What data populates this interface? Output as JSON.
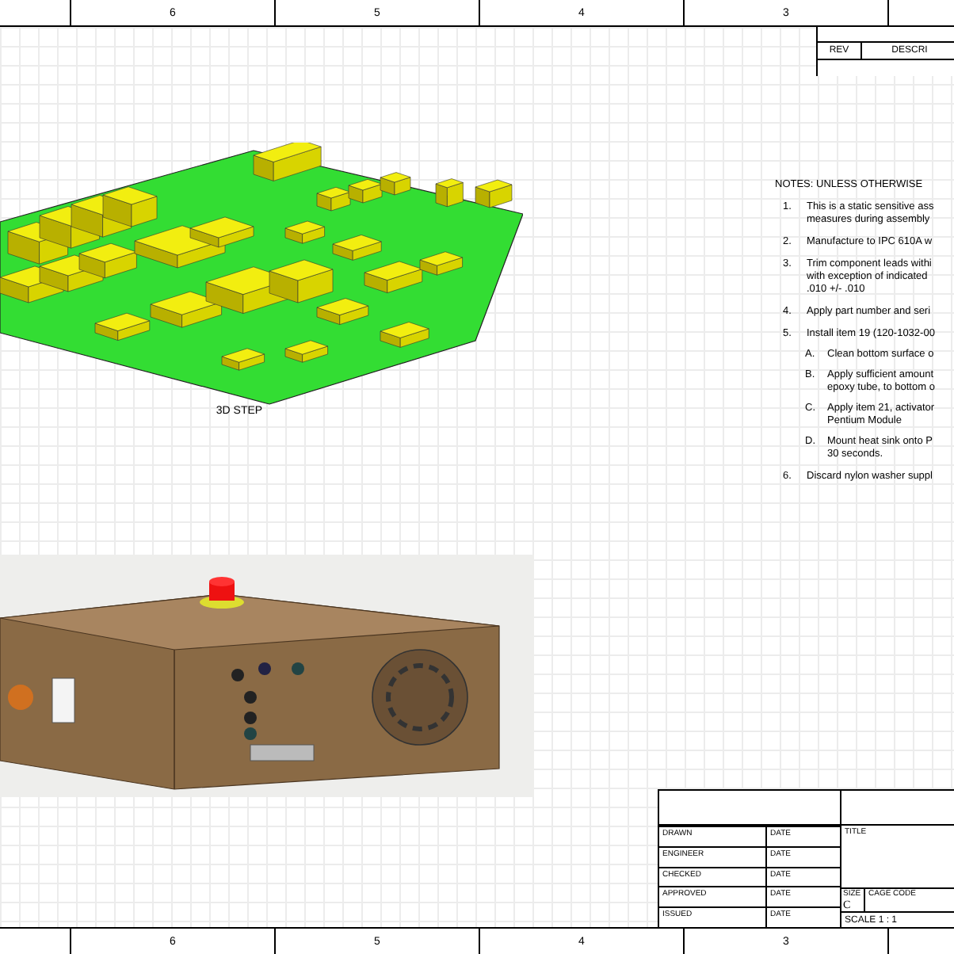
{
  "zone_strip_top": {
    "zones": [
      "6",
      "5",
      "4",
      "3"
    ]
  },
  "revision_table": {
    "columns": [
      "REV",
      "DESCRI"
    ]
  },
  "board_view": {
    "caption": "3D STEP"
  },
  "notes": {
    "heading": "NOTES: UNLESS OTHERWISE",
    "items": [
      {
        "number": "1.",
        "text": "This is a static sensitive ass\nmeasures during assembly"
      },
      {
        "number": "2.",
        "text": "Manufacture to IPC 610A w"
      },
      {
        "number": "3.",
        "text": "Trim component leads withi\nwith exception of indicated\n.010 +/- .010"
      },
      {
        "number": "4.",
        "text": "Apply part number and seri"
      },
      {
        "number": "5.",
        "text": "Install item 19 (120-1032-00",
        "children": [
          {
            "number": "A.",
            "text": "Clean bottom surface o"
          },
          {
            "number": "B.",
            "text": "Apply sufficient amount\nepoxy tube, to bottom o"
          },
          {
            "number": "C.",
            "text": "Apply item 21, activator\nPentium Module"
          },
          {
            "number": "D.",
            "text": "Mount heat sink onto P\n30 seconds."
          }
        ]
      },
      {
        "number": "6.",
        "text": "Discard nylon washer suppl"
      }
    ]
  },
  "title_block": {
    "sign_rows": [
      {
        "label": "DRAWN",
        "date_label": "DATE"
      },
      {
        "label": "ENGINEER",
        "date_label": "DATE"
      },
      {
        "label": "CHECKED",
        "date_label": "DATE"
      },
      {
        "label": "APPROVED",
        "date_label": "DATE"
      },
      {
        "label": "ISSUED",
        "date_label": "DATE"
      }
    ],
    "title_label": "TITLE",
    "size_label": "SIZE",
    "size": "C",
    "cage_code_label": "CAGE CODE",
    "scale": "SCALE 1 : 1"
  },
  "zone_strip_bottom": {
    "zones": [
      "6",
      "5",
      "4",
      "3"
    ]
  }
}
